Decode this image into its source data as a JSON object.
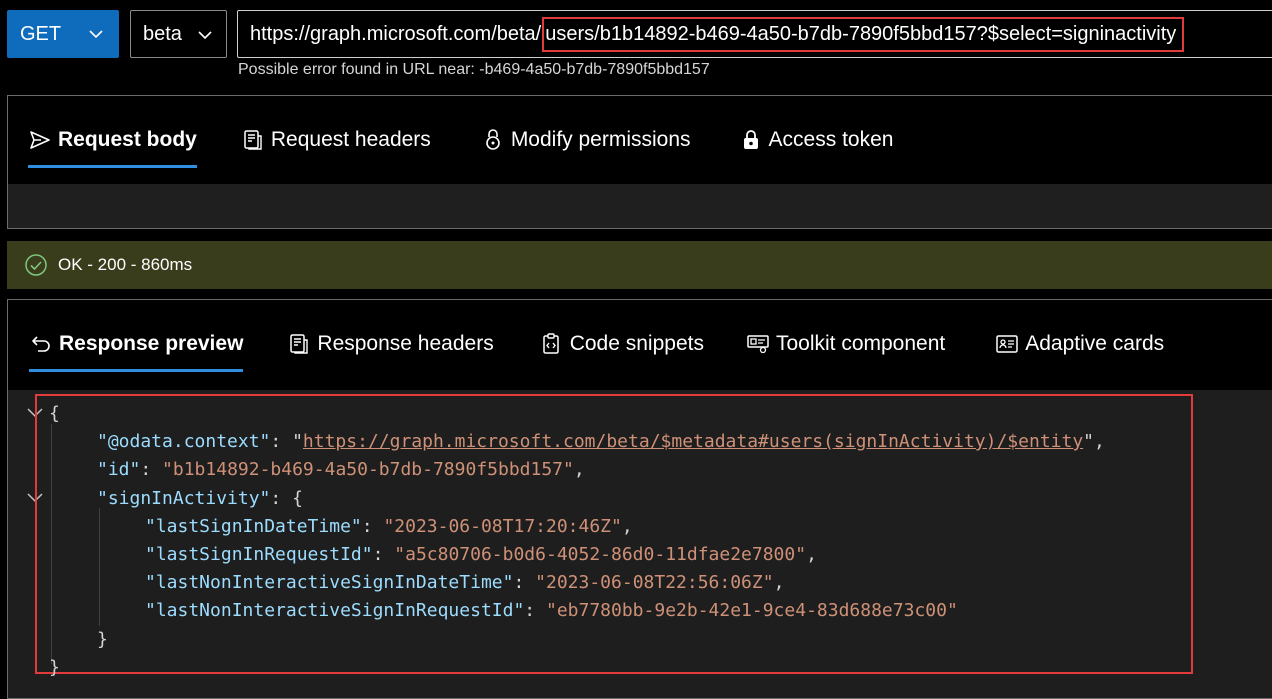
{
  "toolbar": {
    "method": "GET",
    "version": "beta",
    "url_base": "https://graph.microsoft.com/beta/",
    "url_path": "users/b1b14892-b469-4a50-b7db-7890f5bbd157?$select=signinactivity",
    "url_hint": "Possible error found in URL near: -b469-4a50-b7db-7890f5bbd157"
  },
  "request_tabs": [
    {
      "label": "Request body",
      "icon": "send-icon",
      "active": true
    },
    {
      "label": "Request headers",
      "icon": "document-header-icon",
      "active": false
    },
    {
      "label": "Modify permissions",
      "icon": "lock-permissions-icon",
      "active": false
    },
    {
      "label": "Access token",
      "icon": "shield-lock-icon",
      "active": false
    }
  ],
  "status": {
    "text": "OK - 200 - 860ms",
    "icon": "checkmark-circle-icon",
    "color": "#393d1b"
  },
  "response_tabs": [
    {
      "label": "Response preview",
      "icon": "arrow-return-icon",
      "active": true
    },
    {
      "label": "Response headers",
      "icon": "document-header-icon",
      "active": false
    },
    {
      "label": "Code snippets",
      "icon": "clipboard-code-icon",
      "active": false
    },
    {
      "label": "Toolkit component",
      "icon": "toolkit-icon",
      "active": false
    },
    {
      "label": "Adaptive cards",
      "icon": "card-icon",
      "active": false
    }
  ],
  "response": {
    "open_brace": "{",
    "context_key": "\"@odata.context\"",
    "context_value": "https://graph.microsoft.com/beta/$metadata#users(signInActivity)/$entity",
    "id_key": "\"id\"",
    "id_value": "\"b1b14892-b469-4a50-b7db-7890f5bbd157\"",
    "signin_key": "\"signInActivity\"",
    "fields": [
      {
        "key": "\"lastSignInDateTime\"",
        "value": "\"2023-06-08T17:20:46Z\""
      },
      {
        "key": "\"lastSignInRequestId\"",
        "value": "\"a5c80706-b0d6-4052-86d0-11dfae2e7800\""
      },
      {
        "key": "\"lastNonInteractiveSignInDateTime\"",
        "value": "\"2023-06-08T22:56:06Z\""
      },
      {
        "key": "\"lastNonInteractiveSignInRequestId\"",
        "value": "\"eb7780bb-9e2b-42e1-9ce4-83d688e73c00\""
      }
    ],
    "inner_close": "}",
    "outer_close": "}"
  },
  "colors": {
    "accent": "#0f6cbd",
    "tab_underline": "#2f8ee0",
    "highlight_border": "#e23b3b",
    "json_key": "#9cdcfe",
    "json_string": "#ce9178"
  }
}
